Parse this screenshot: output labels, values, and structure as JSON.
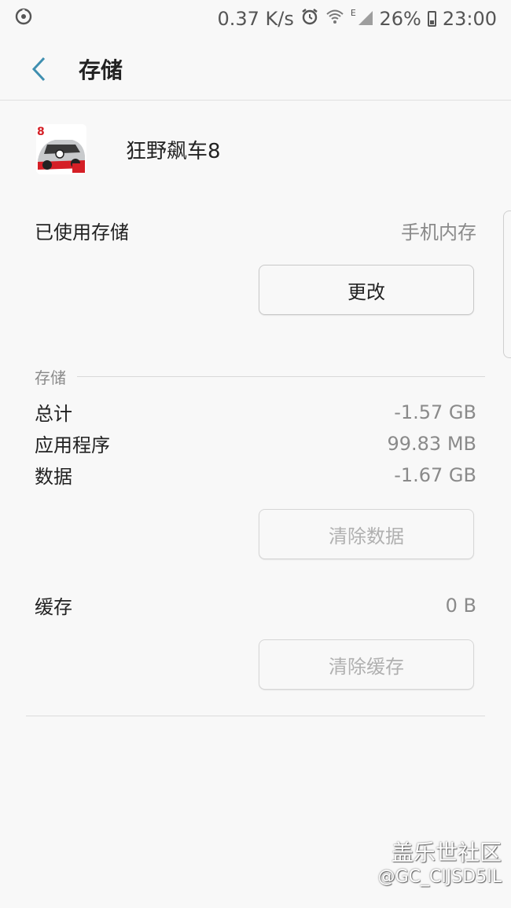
{
  "status_bar": {
    "speed": "0.37 K/s",
    "network_type": "E",
    "battery": "26%",
    "time": "23:00"
  },
  "header": {
    "title": "存储"
  },
  "app": {
    "name": "狂野飙车8"
  },
  "storage_used": {
    "label": "已使用存储",
    "value": "手机内存",
    "change_button": "更改"
  },
  "storage": {
    "section_title": "存储",
    "rows": [
      {
        "label": "总计",
        "value": "-1.57 GB"
      },
      {
        "label": "应用程序",
        "value": "99.83 MB"
      },
      {
        "label": "数据",
        "value": "-1.67 GB"
      }
    ],
    "clear_data_button": "清除数据"
  },
  "cache": {
    "label": "缓存",
    "value": "0 B",
    "clear_cache_button": "清除缓存"
  },
  "watermark": {
    "line1": "盖乐世社区",
    "line2": "@GC_CIJSD5IL"
  }
}
